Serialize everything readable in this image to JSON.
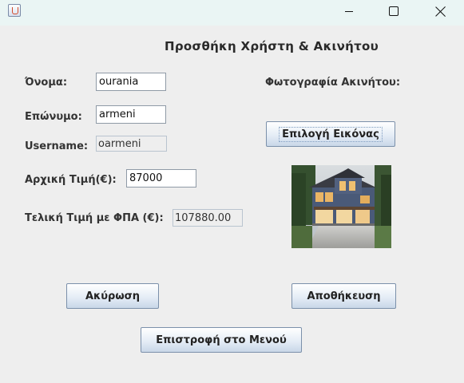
{
  "window": {
    "title": "",
    "controls": {
      "minimize": "minimize-icon",
      "maximize": "maximize-icon",
      "close": "close-icon"
    }
  },
  "form": {
    "heading": "Προσθήκη Χρήστη & Ακινήτου",
    "first_name": {
      "label": "Όνομα:",
      "value": "ourania"
    },
    "last_name": {
      "label": "Επώνυμο:",
      "value": "armeni"
    },
    "username": {
      "label": "Username:",
      "value": "oarmeni"
    },
    "initial_price": {
      "label": "Αρχική Τιμή(€):",
      "value": "87000"
    },
    "final_price": {
      "label": "Τελική Τιμή με ΦΠΑ (€):",
      "value": "107880.00"
    },
    "photo_label": "Φωτογραφία Ακινήτου:",
    "choose_image_button": "Επιλογή Εικόνας",
    "cancel_button": "Ακύρωση",
    "save_button": "Αποθήκευση",
    "back_button": "Επιστροφή στο Μενού"
  },
  "colors": {
    "window_bg": "#eeeeee",
    "titlebar_bg": "#eaf5f4",
    "button_border": "#7b90aa"
  }
}
